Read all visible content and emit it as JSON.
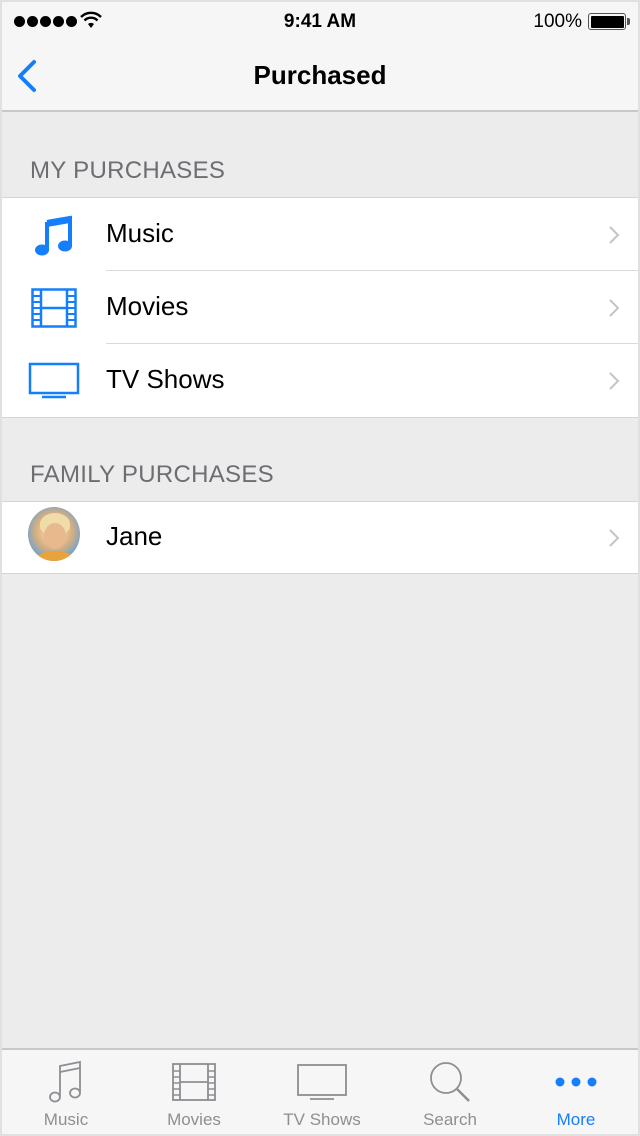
{
  "status_bar": {
    "signal_dots": 5,
    "time": "9:41 AM",
    "battery_percent": "100%",
    "battery_level": 1.0
  },
  "nav": {
    "back_icon": "chevron-left-icon",
    "title": "Purchased"
  },
  "sections": [
    {
      "header": "MY PURCHASES",
      "items": [
        {
          "label": "Music",
          "icon": "music-note-icon"
        },
        {
          "label": "Movies",
          "icon": "film-icon"
        },
        {
          "label": "TV Shows",
          "icon": "tv-icon"
        }
      ]
    },
    {
      "header": "FAMILY PURCHASES",
      "items": [
        {
          "label": "Jane",
          "icon": "avatar"
        }
      ]
    }
  ],
  "tab_bar": {
    "tabs": [
      {
        "label": "Music",
        "icon": "music-note-icon",
        "active": false
      },
      {
        "label": "Movies",
        "icon": "film-icon",
        "active": false
      },
      {
        "label": "TV Shows",
        "icon": "tv-icon",
        "active": false
      },
      {
        "label": "Search",
        "icon": "search-icon",
        "active": false
      },
      {
        "label": "More",
        "icon": "more-dots-icon",
        "active": true
      }
    ]
  },
  "colors": {
    "accent": "#157efb",
    "inactive": "#8e8e93",
    "section_header": "#6d6d72",
    "background": "#ececec"
  }
}
